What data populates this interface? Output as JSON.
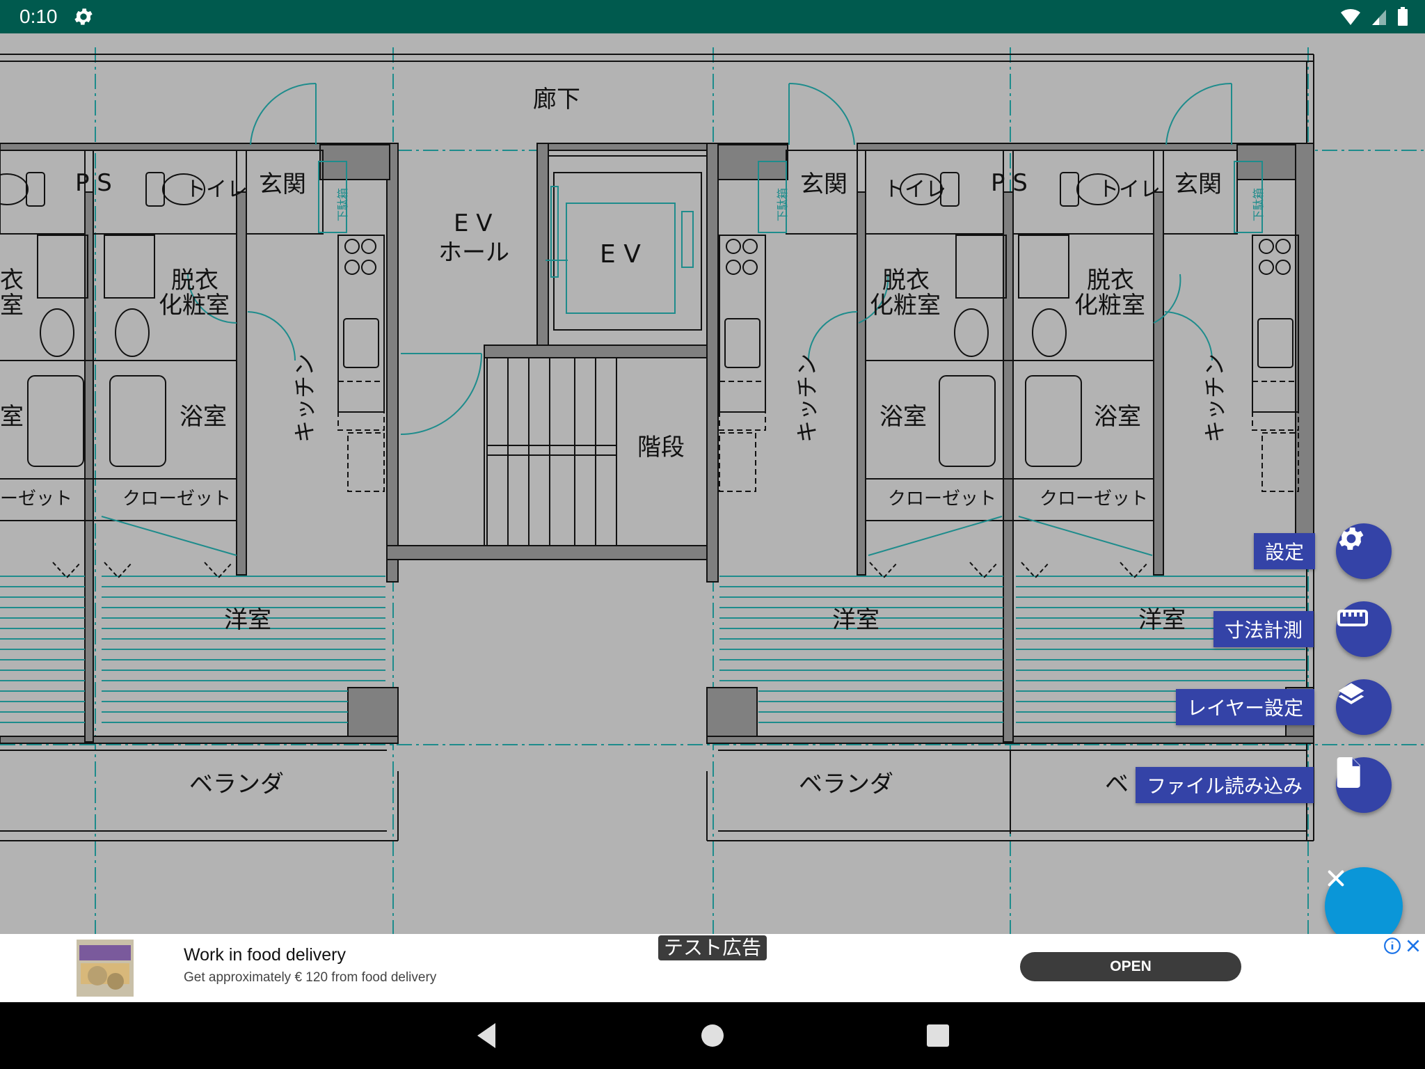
{
  "status_bar": {
    "time": "0:10"
  },
  "floor_plan": {
    "corridor": "廊下",
    "ps": "P S",
    "toilet": "トイレ",
    "entrance": "玄関",
    "shoe_box": "下駄箱",
    "ev_hall_line1": "E V",
    "ev_hall_line2": "ホール",
    "elevator": "E V",
    "dressing_line1": "脱衣",
    "dressing_line2": "化粧室",
    "dressing_cut_line1": "衣",
    "dressing_cut_line2": "室",
    "kitchen": "キッチン",
    "bath": "浴室",
    "bath_cut": "室",
    "closet": "クローゼット",
    "closet_cut": "ーゼット",
    "stairs": "階段",
    "western_room": "洋室",
    "veranda": "ベランダ",
    "veranda_cut": "ベ",
    "colors": {
      "wall": "#808080",
      "accent": "#1e8c8c",
      "background": "#b3b3b3"
    }
  },
  "fab_menu": {
    "items": [
      {
        "label": "設定",
        "icon": "gear-icon"
      },
      {
        "label": "寸法計測",
        "icon": "ruler-icon"
      },
      {
        "label": "レイヤー設定",
        "icon": "layers-icon"
      },
      {
        "label": "ファイル読み込み",
        "icon": "file-icon"
      }
    ],
    "main_icon": "close-icon",
    "colors": {
      "mini_fab": "#3443a7",
      "main_fab": "#0a96d8"
    }
  },
  "ad": {
    "badge": "テスト広告",
    "title": "Work in food delivery",
    "description": "Get approximately € 120 from food delivery",
    "cta": "OPEN"
  },
  "colors": {
    "status_bar": "#005a4e"
  }
}
